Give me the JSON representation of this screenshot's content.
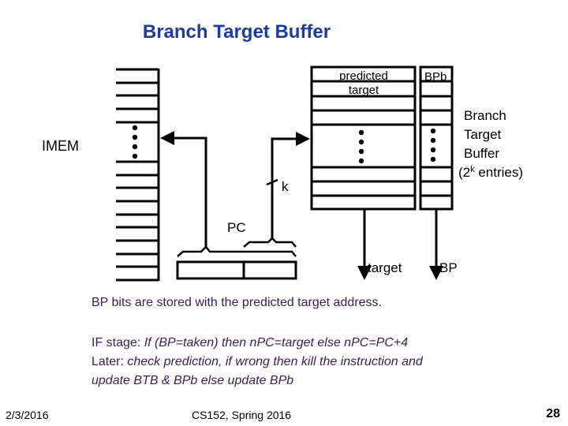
{
  "slide": {
    "title": "Branch Target Buffer",
    "colors": {
      "title": "#1c3ca4",
      "body_text": "#3b1f4f",
      "diagram_stroke": "#000000"
    },
    "diagram": {
      "imem_label": "IMEM",
      "btb_header_line1": "predicted",
      "btb_header_line2": "target",
      "bpb_header": "BPb",
      "btb_caption": {
        "line1": "Branch",
        "line2": "Target",
        "line3": "Buffer",
        "line4_prefix": "(2",
        "line4_superscript": "k",
        "line4_suffix": " entries)"
      },
      "index_width_label": "k",
      "pc_label": "PC",
      "target_output_label": "target",
      "bp_output_label": "BP"
    },
    "notes": {
      "bp_bits": "BP bits are stored with the predicted target address.",
      "if_stage": {
        "label": "IF stage: ",
        "text": "If (BP=taken) then nPC=target else nPC=PC+4"
      },
      "later": {
        "label": "Later: ",
        "text_line1": "check prediction, if wrong then kill the instruction and",
        "text_line2": "update BTB & BPb else update BPb"
      }
    }
  },
  "footer": {
    "date": "2/3/2016",
    "course": "CS152, Spring 2016",
    "page_number": "28"
  }
}
